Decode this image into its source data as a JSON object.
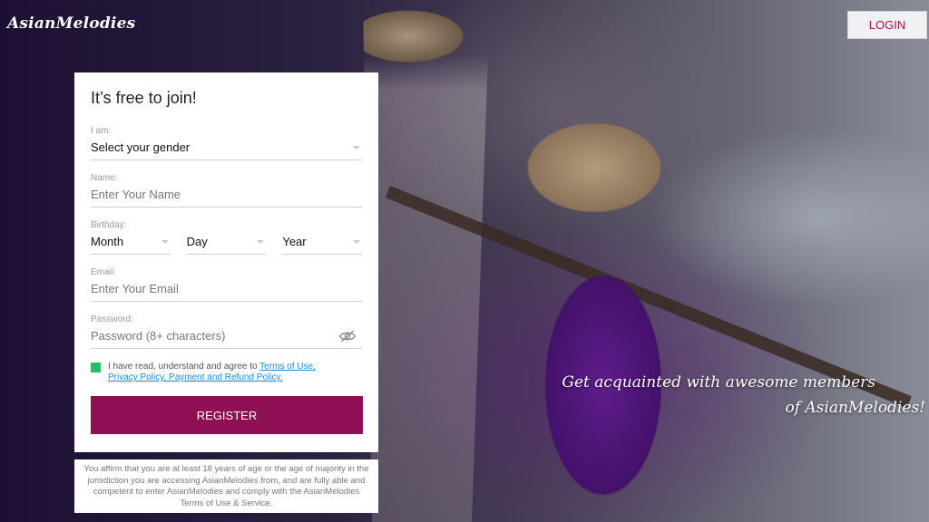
{
  "brand": {
    "logo": "AsianMelodies"
  },
  "header": {
    "login_label": "LOGIN"
  },
  "form": {
    "title": "It’s free to join!",
    "gender": {
      "label": "I am:",
      "value": "Select your gender"
    },
    "name": {
      "label": "Name:",
      "placeholder": "Enter Your Name"
    },
    "birthday": {
      "label": "Birthday:",
      "month": "Month",
      "day": "Day",
      "year": "Year"
    },
    "email": {
      "label": "Email:",
      "placeholder": "Enter Your Email"
    },
    "password": {
      "label": "Password:",
      "placeholder": "Password (8+ characters)"
    },
    "agree": {
      "text": "I have read, understand and agree to ",
      "terms_link": "Terms of Use,",
      "policy_link": "Privacy Policy, Payment and Refund Policy.",
      "checked": true
    },
    "register_label": "REGISTER"
  },
  "disclaimer": "You affirm that you are at least 18 years of age or the age of majority in the jurisdiction you are accessing AsianMelodies from, and are fully able and competent to enter AsianMelodies and comply with the AsianMelodies Terms of Use & Service.",
  "tagline": {
    "line1": "Get acquainted with awesome members",
    "line2": "of AsianMelodies!"
  },
  "colors": {
    "accent": "#8f0f55",
    "checkbox": "#23c06a",
    "link": "#1e88d6"
  },
  "icons": {
    "password_toggle": "eye-off-icon"
  }
}
